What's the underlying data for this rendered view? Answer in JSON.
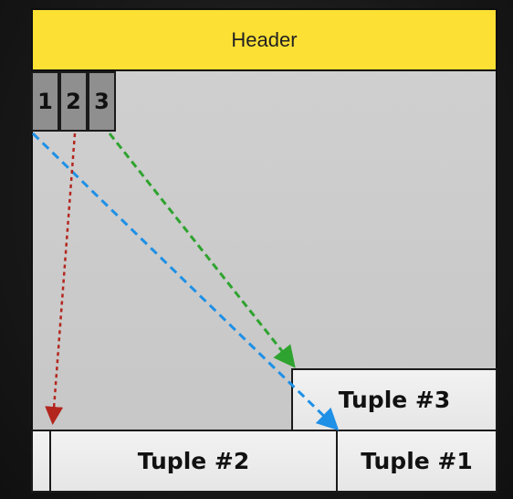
{
  "header": {
    "label": "Header"
  },
  "slots": [
    {
      "label": "1"
    },
    {
      "label": "2"
    },
    {
      "label": "3"
    }
  ],
  "tuples": [
    {
      "label": "Tuple #3"
    },
    {
      "label": "Tuple #2"
    },
    {
      "label": "Tuple #1"
    }
  ],
  "colors": {
    "header": "#fce034",
    "page_background": "#cdcdcd",
    "slot_fill": "#8f8f8f",
    "tuple_fill": "#ececec",
    "arrow_slot_1": "#1e90e6",
    "arrow_slot_2": "#b3261e",
    "arrow_slot_3": "#2fa32f"
  },
  "pointers": [
    {
      "from": "1",
      "to": "Tuple #1"
    },
    {
      "from": "2",
      "to": "Tuple #2"
    },
    {
      "from": "3",
      "to": "Tuple #3"
    }
  ]
}
